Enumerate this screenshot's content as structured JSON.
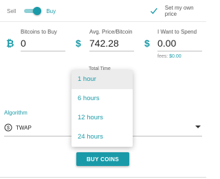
{
  "toggle": {
    "left_label": "Sell",
    "right_label": "Buy",
    "state": "Buy"
  },
  "own_price": {
    "label": "Set my own price",
    "checked": true
  },
  "fields": {
    "bitcoins": {
      "caption": "Bitcoins to Buy",
      "value": "0",
      "currency_icon": "bitcoin-icon"
    },
    "avg_price": {
      "caption": "Avg. Price/Bitcoin",
      "value": "742.28",
      "currency_icon": "dollar-icon"
    },
    "spend": {
      "caption": "I Want to Spend",
      "value": "0.00",
      "currency_icon": "dollar-icon"
    }
  },
  "fees": {
    "label": "fees:",
    "amount": "$0.00"
  },
  "total_time": {
    "label": "Total Time"
  },
  "dropdown": {
    "options": [
      "1 hour",
      "6 hours",
      "12 hours",
      "24 hours"
    ],
    "highlighted": "1 hour"
  },
  "algorithm": {
    "label": "Algorithm",
    "value": "TWAP",
    "icon": "coin-icon"
  },
  "buy_button": {
    "label": "BUY COINS"
  },
  "colors": {
    "accent": "#1a9aa8",
    "menu_highlight": "#ececec"
  }
}
